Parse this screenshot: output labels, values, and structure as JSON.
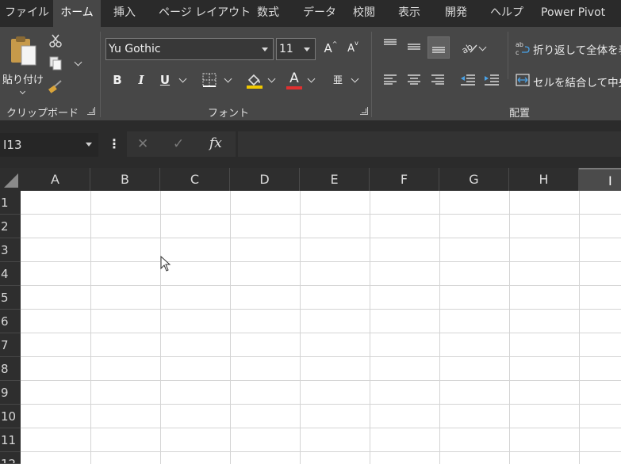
{
  "tabs": [
    {
      "label": "ファイル",
      "active": false
    },
    {
      "label": "ホーム",
      "active": true
    },
    {
      "label": "挿入",
      "active": false
    },
    {
      "label": "ページ レイアウト",
      "active": false
    },
    {
      "label": "数式",
      "active": false
    },
    {
      "label": "データ",
      "active": false
    },
    {
      "label": "校閲",
      "active": false
    },
    {
      "label": "表示",
      "active": false
    },
    {
      "label": "開発",
      "active": false
    },
    {
      "label": "ヘルプ",
      "active": false
    },
    {
      "label": "Power Pivot",
      "active": false
    }
  ],
  "ribbon": {
    "clipboard": {
      "paste_label": "貼り付け",
      "group_label": "クリップボード"
    },
    "font": {
      "font_name": "Yu Gothic",
      "font_size": "11",
      "increase_glyph": "A",
      "decrease_glyph": "A",
      "bold": "B",
      "italic": "I",
      "underline": "U",
      "font_color_glyph": "A",
      "phonetic_glyph": "亜",
      "group_label": "フォント"
    },
    "alignment": {
      "wrap_label": "折り返して全体を表",
      "merge_label": "セルを結合して中央",
      "group_label": "配置"
    }
  },
  "formula_bar": {
    "name_box": "I13",
    "fx": "fx",
    "cancel": "✕",
    "enter": "✓",
    "dots": "⋮"
  },
  "grid": {
    "columns": [
      "A",
      "B",
      "C",
      "D",
      "E",
      "F",
      "G",
      "H",
      "I"
    ],
    "rows": [
      "1",
      "2",
      "3",
      "4",
      "5",
      "6",
      "7",
      "8",
      "9",
      "10",
      "11",
      "12"
    ],
    "selected_column": "I"
  },
  "colors": {
    "accent_font": "#e03030",
    "fill_yellow": "#f0c800"
  }
}
